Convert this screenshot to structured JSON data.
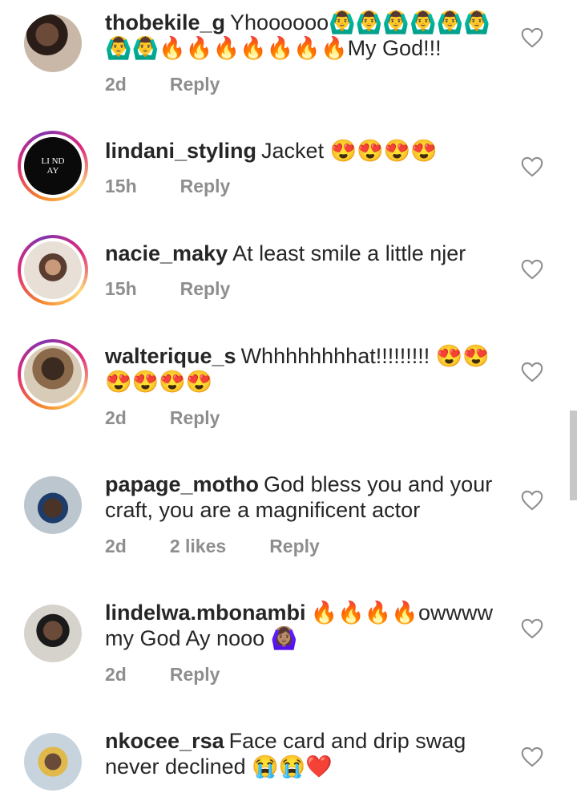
{
  "comments": [
    {
      "username": "thobekile_g",
      "text": "Yhoooooo🙆‍♂️🙆‍♂️🙆‍♂️🙆‍♂️🙆‍♂️🙆‍♂️🙆‍♂️🙆‍♂️🔥🔥🔥🔥🔥🔥🔥My God!!!",
      "time": "2d",
      "likes": "",
      "reply_label": "Reply"
    },
    {
      "username": "lindani_styling",
      "text": "Jacket 😍😍😍😍",
      "time": "15h",
      "likes": "",
      "reply_label": "Reply"
    },
    {
      "username": "nacie_maky",
      "text": "At least smile a little njer",
      "time": "15h",
      "likes": "",
      "reply_label": "Reply"
    },
    {
      "username": "walterique_s",
      "text": "Whhhhhhhhat!!!!!!!!! 😍😍😍😍😍😍",
      "time": "2d",
      "likes": "",
      "reply_label": "Reply"
    },
    {
      "username": "papage_motho",
      "text": "God bless you and your craft, you are a magnificent actor",
      "time": "2d",
      "likes": "2 likes",
      "reply_label": "Reply"
    },
    {
      "username": "lindelwa.mbonambi",
      "text": "🔥🔥🔥🔥owwww my God Ay nooo 🙆🏽‍♀️",
      "time": "2d",
      "likes": "",
      "reply_label": "Reply"
    },
    {
      "username": "nkocee_rsa",
      "text": "Face card and drip swag never declined 😭😭❤️",
      "time": "",
      "likes": "",
      "reply_label": ""
    }
  ],
  "avatar_texts": {
    "lindani_logo": "LI ND AY"
  },
  "colors": {
    "username": "#262626",
    "meta": "#8e8e8e",
    "heart_outline": "#8e8e8e",
    "story_ring_start": "#f58529",
    "story_ring_end": "#dd2a7b"
  }
}
